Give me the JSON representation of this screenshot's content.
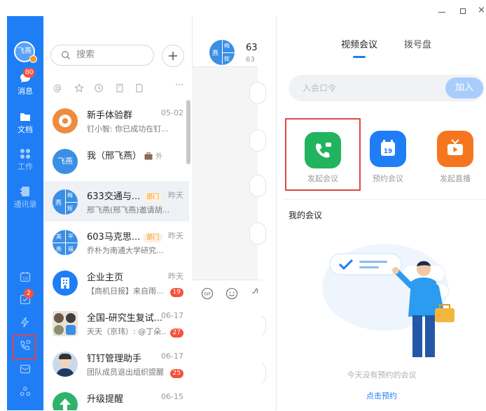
{
  "window": {
    "controls": [
      "minimize",
      "maximize",
      "close"
    ]
  },
  "rail": {
    "profile_name": "飞燕",
    "messages_label": "消息",
    "messages_badge": "80",
    "docs_label": "文档",
    "work_label": "工作",
    "contacts_label": "通讯录",
    "calendar_day": "19",
    "todo_badge": "2"
  },
  "list": {
    "search_placeholder": "搜索",
    "chats": [
      {
        "title": "新手体验群",
        "time": "05-02",
        "message": "钉小智: 你已成功在钉...",
        "avatar_text": "",
        "avatar_color": "#f08a3c"
      },
      {
        "title": "我（邢飞燕）",
        "time": "",
        "message": "",
        "external": "外",
        "avatar_text": "飞燕",
        "avatar_color": "#3a8ee6"
      },
      {
        "title": "633交通与...",
        "tag": "部门",
        "time": "昨天",
        "message": "邢飞燕(邢飞燕)邀请胡...",
        "avatar_text": [
          "梅",
          "燕",
          "辉"
        ],
        "avatar_color": "#3a8ee6"
      },
      {
        "title": "603马克思...",
        "tag": "部门",
        "time": "昨天",
        "message": "乔朴为南通大学研究...",
        "avatar_text": [
          "美",
          "平",
          "燕",
          "福"
        ],
        "avatar_color": "#3a8ee6"
      },
      {
        "title": "企业主页",
        "time": "昨天",
        "message": "【商机日报】来自雨...",
        "badge": "19",
        "avatar_color": "#1f7ef5"
      },
      {
        "title": "全国-研究生复试...",
        "time": "06-17",
        "message": "天天（京玮）: @丁朵...",
        "badge": "27"
      },
      {
        "title": "钉钉管理助手",
        "time": "06-17",
        "message": "团队成员退出组织提醒",
        "badge": "25"
      },
      {
        "title": "升级提醒",
        "time": "06-15",
        "message": "",
        "avatar_color": "#2fb36b"
      }
    ]
  },
  "mid": {
    "title_partial": "63",
    "sub_partial": "63",
    "avatar_text": [
      "梅",
      "燕",
      "辉"
    ]
  },
  "video": {
    "tab_video": "视频会议",
    "tab_dial": "拨号盘",
    "join_placeholder": "入会口令",
    "join_button": "加入",
    "start_label": "发起会议",
    "schedule_label": "预约会议",
    "schedule_day": "19",
    "live_label": "发起直播",
    "my_meetings": "我的会议",
    "empty_text": "今天没有预约的会议",
    "schedule_link": "点击预约",
    "accent": "#1f7ef5"
  }
}
